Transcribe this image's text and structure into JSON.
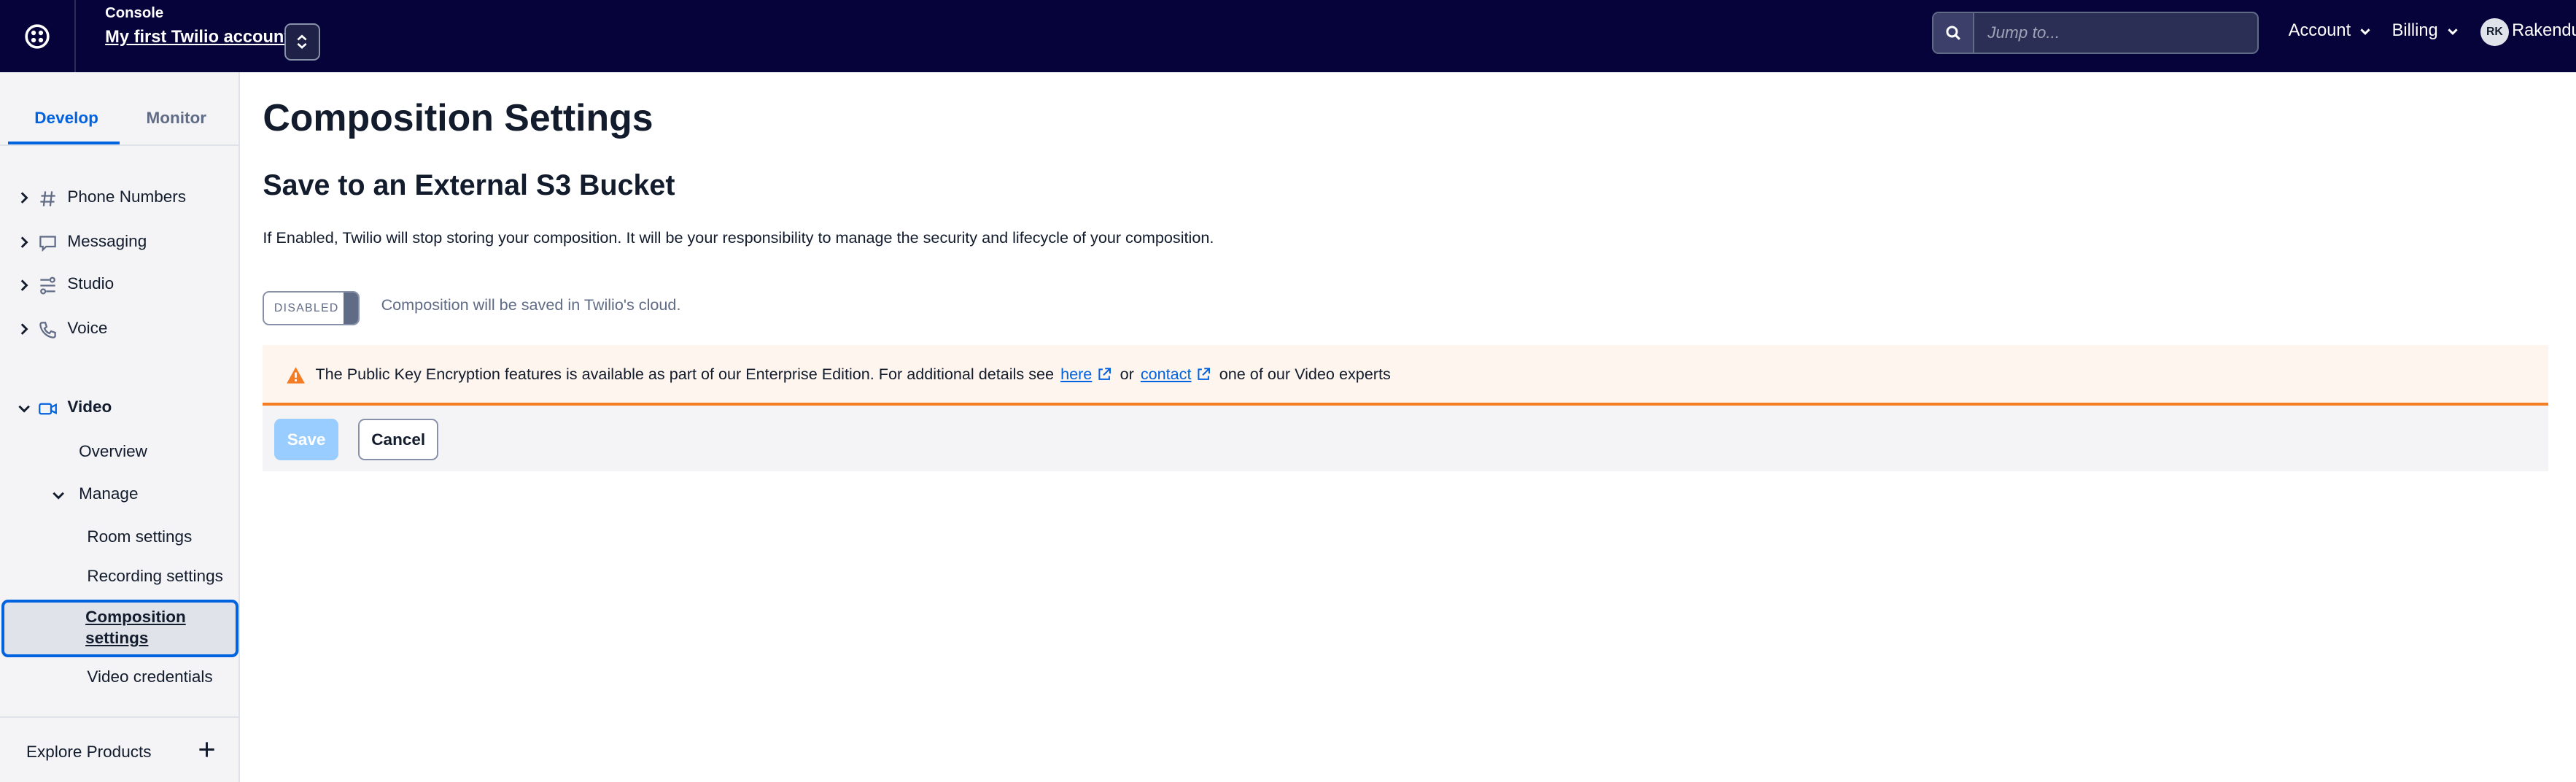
{
  "topbar": {
    "console_label": "Console",
    "account_name": "My first Twilio account",
    "search_placeholder": "Jump to...",
    "account_menu": "Account",
    "billing_menu": "Billing",
    "avatar_initials": "RK",
    "user_name": "Rakendu"
  },
  "sidebar": {
    "tabs": [
      {
        "label": "Develop",
        "active": true
      },
      {
        "label": "Monitor",
        "active": false
      }
    ],
    "items": [
      {
        "label": "Phone Numbers",
        "icon": "hash-icon"
      },
      {
        "label": "Messaging",
        "icon": "chat-icon"
      },
      {
        "label": "Studio",
        "icon": "studio-icon"
      },
      {
        "label": "Voice",
        "icon": "phone-icon"
      },
      {
        "label": "Video",
        "icon": "video-icon"
      }
    ],
    "video_sub": {
      "overview": "Overview",
      "manage": "Manage",
      "room_settings": "Room settings",
      "recording_settings": "Recording settings",
      "composition_settings": "Composition settings",
      "video_credentials": "Video credentials"
    },
    "explore": "Explore Products"
  },
  "main": {
    "page_title": "Composition Settings",
    "section_title": "Save to an External S3 Bucket",
    "description": "If Enabled, Twilio will stop storing your composition. It will be your responsibility to manage the security and lifecycle of your composition.",
    "toggle_state": "DISABLED",
    "toggle_caption": "Composition will be saved in Twilio's cloud.",
    "alert": {
      "text_before": "The Public Key Encryption features is available as part of our Enterprise Edition. For additional details see",
      "link_here": "here",
      "text_or": "or",
      "link_contact": "contact",
      "text_after": "one of our Video experts"
    },
    "save_label": "Save",
    "cancel_label": "Cancel"
  },
  "colors": {
    "topbar": "#06033a",
    "accent": "#0263e0",
    "warning": "#f47c22",
    "warning_bg": "#fef5ee",
    "disabled_button": "#99cdff"
  }
}
